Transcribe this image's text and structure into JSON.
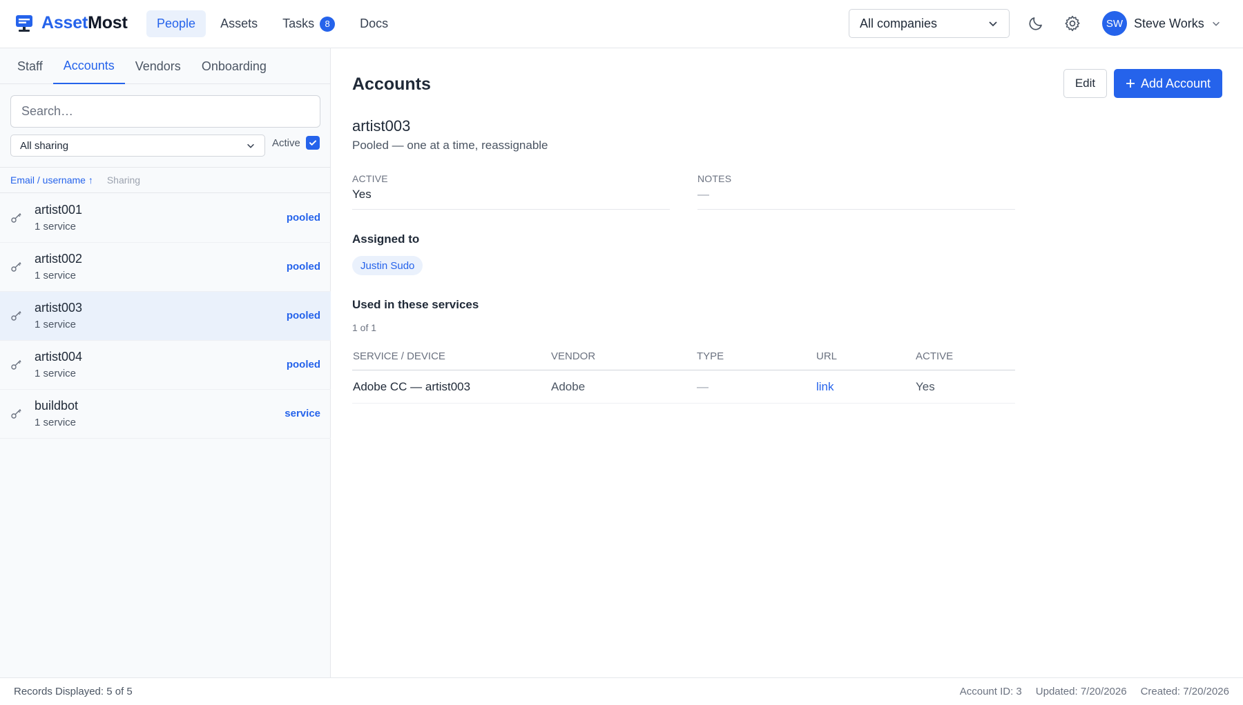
{
  "app": {
    "logo_part1": "Asset",
    "logo_part2": "Most",
    "brand_color": "#2563eb"
  },
  "nav": {
    "items": [
      {
        "label": "People",
        "active": true
      },
      {
        "label": "Assets"
      },
      {
        "label": "Tasks",
        "badge": "8"
      },
      {
        "label": "Docs"
      }
    ]
  },
  "header": {
    "company_select": "All companies",
    "user_initials": "SW",
    "user_name": "Steve Works"
  },
  "sidebar": {
    "tabs": [
      "Staff",
      "Accounts",
      "Vendors",
      "Onboarding"
    ],
    "active_tab": "Accounts",
    "search_placeholder": "Search…",
    "sharing_filter": "All sharing",
    "active_label": "Active",
    "active_checked": true,
    "col_email": "Email / username ↑",
    "col_sharing": "Sharing",
    "rows": [
      {
        "name": "artist001",
        "sub": "1 service",
        "tag": "pooled"
      },
      {
        "name": "artist002",
        "sub": "1 service",
        "tag": "pooled"
      },
      {
        "name": "artist003",
        "sub": "1 service",
        "tag": "pooled",
        "selected": true
      },
      {
        "name": "artist004",
        "sub": "1 service",
        "tag": "pooled"
      },
      {
        "name": "buildbot",
        "sub": "1 service",
        "tag": "service"
      }
    ]
  },
  "main": {
    "title": "Accounts",
    "edit_label": "Edit",
    "add_label": "Add Account",
    "account_name": "artist003",
    "account_desc": "Pooled — one at a time, reassignable",
    "active_label": "ACTIVE",
    "active_value": "Yes",
    "notes_label": "NOTES",
    "notes_value": "—",
    "assigned_title": "Assigned to",
    "assigned_person": "Justin Sudo",
    "services_title": "Used in these services",
    "services_count": "1 of 1",
    "table": {
      "headers": [
        "SERVICE / DEVICE",
        "VENDOR",
        "TYPE",
        "URL",
        "ACTIVE"
      ],
      "rows": [
        {
          "service": "Adobe CC — artist003",
          "vendor": "Adobe",
          "type": "—",
          "url": "link",
          "active": "Yes"
        }
      ]
    }
  },
  "footer": {
    "records": "Records Displayed: 5 of 5",
    "account_id": "Account ID: 3",
    "updated": "Updated: 7/20/2026",
    "created": "Created: 7/20/2026"
  }
}
